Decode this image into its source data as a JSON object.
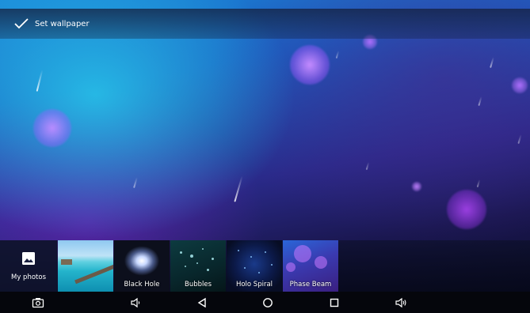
{
  "actionbar": {
    "set_wallpaper_label": "Set wallpaper",
    "icon": "checkmark-icon"
  },
  "picker": {
    "my_photos": {
      "label": "My photos",
      "icon": "image-icon"
    },
    "items": [
      {
        "label": ""
      },
      {
        "label": "Black Hole"
      },
      {
        "label": "Bubbles"
      },
      {
        "label": "Holo Spiral"
      },
      {
        "label": "Phase Beam"
      }
    ]
  },
  "navbar": {
    "buttons": [
      {
        "icon": "screenshot-icon"
      },
      {
        "icon": "volume-down-icon"
      },
      {
        "icon": "back-icon"
      },
      {
        "icon": "home-icon"
      },
      {
        "icon": "recents-icon"
      },
      {
        "icon": "volume-up-icon"
      }
    ]
  },
  "colors": {
    "wallpaper_top": "#1b86d8",
    "wallpaper_bottom": "#0a0a24",
    "orb_purple": "#a05cff",
    "navbar_bg": "#05060c"
  }
}
